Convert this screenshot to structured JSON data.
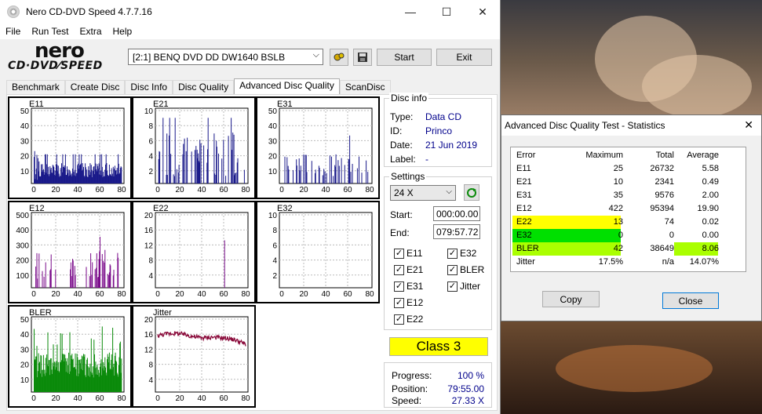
{
  "window": {
    "title": "Nero CD-DVD Speed 4.7.7.16",
    "min": "—",
    "max": "☐",
    "close": "✕"
  },
  "menu": [
    "File",
    "Run Test",
    "Extra",
    "Help"
  ],
  "logo": {
    "top": "nero",
    "bottom": "CD·DVD⁄SPEED"
  },
  "drive": {
    "value": "[2:1]   BENQ DVD DD DW1640 BSLB"
  },
  "buttons": {
    "start": "Start",
    "exit": "Exit"
  },
  "tabs": [
    "Benchmark",
    "Create Disc",
    "Disc Info",
    "Disc Quality",
    "Advanced Disc Quality",
    "ScanDisc"
  ],
  "active_tab": "Advanced Disc Quality",
  "disc_info": {
    "title": "Disc info",
    "type_label": "Type:",
    "type": "Data CD",
    "id_label": "ID:",
    "id": "Princo",
    "date_label": "Date:",
    "date": "21 Jun 2019",
    "label_label": "Label:",
    "label": "-"
  },
  "settings": {
    "title": "Settings",
    "speed": "24 X",
    "start_label": "Start:",
    "start": "000:00.00",
    "end_label": "End:",
    "end": "079:57.72",
    "checks": [
      {
        "label": "E11",
        "checked": true
      },
      {
        "label": "E32",
        "checked": true
      },
      {
        "label": "E21",
        "checked": true
      },
      {
        "label": "BLER",
        "checked": true
      },
      {
        "label": "E31",
        "checked": true
      },
      {
        "label": "Jitter",
        "checked": true
      },
      {
        "label": "E12",
        "checked": true
      },
      {
        "label": "E22",
        "checked": true
      }
    ]
  },
  "class": "Class 3",
  "progress": {
    "progress_label": "Progress:",
    "progress": "100 %",
    "position_label": "Position:",
    "position": "79:55.00",
    "speed_label": "Speed:",
    "speed": "27.33 X"
  },
  "stats": {
    "title": "Advanced Disc Quality Test - Statistics",
    "close": "✕",
    "headers": [
      "Error",
      "Maximum",
      "Total",
      "Average"
    ],
    "rows": [
      {
        "name": "E11",
        "max": "25",
        "total": "26732",
        "avg": "5.58"
      },
      {
        "name": "E21",
        "max": "10",
        "total": "2341",
        "avg": "0.49"
      },
      {
        "name": "E31",
        "max": "35",
        "total": "9576",
        "avg": "2.00"
      },
      {
        "name": "E12",
        "max": "422",
        "total": "95394",
        "avg": "19.90"
      },
      {
        "name": "E22",
        "max": "13",
        "total": "74",
        "avg": "0.02"
      },
      {
        "name": "E32",
        "max": "0",
        "total": "0",
        "avg": "0.00"
      },
      {
        "name": "BLER",
        "max": "42",
        "total": "38649",
        "avg": "8.06"
      },
      {
        "name": "Jitter",
        "max": "17.5%",
        "total": "n/a",
        "avg": "14.07%"
      }
    ],
    "copy": "Copy",
    "close_btn": "Close"
  },
  "colors": {
    "blue": "#1a1a8a",
    "purple": "#7a0a8a",
    "green": "#0a8a0a",
    "maroon": "#8a0a3a"
  },
  "chart_data": [
    {
      "type": "bar",
      "title": "E11",
      "xticks": [
        "0",
        "20",
        "40",
        "60",
        "80"
      ],
      "yticks": [
        "50",
        "40",
        "30",
        "20",
        "10"
      ],
      "ylim": [
        0,
        50
      ],
      "xlim": [
        0,
        80
      ],
      "color": "blue"
    },
    {
      "type": "bar",
      "title": "E21",
      "xticks": [
        "0",
        "20",
        "40",
        "60",
        "80"
      ],
      "yticks": [
        "10",
        "8",
        "6",
        "4",
        "2"
      ],
      "ylim": [
        0,
        10
      ],
      "xlim": [
        0,
        80
      ],
      "color": "blue"
    },
    {
      "type": "bar",
      "title": "E31",
      "xticks": [
        "0",
        "20",
        "40",
        "60",
        "80"
      ],
      "yticks": [
        "50",
        "40",
        "30",
        "20",
        "10"
      ],
      "ylim": [
        0,
        50
      ],
      "xlim": [
        0,
        80
      ],
      "color": "blue"
    },
    {
      "type": "bar",
      "title": "E12",
      "xticks": [
        "0",
        "20",
        "40",
        "60",
        "80"
      ],
      "yticks": [
        "500",
        "400",
        "300",
        "200",
        "100"
      ],
      "ylim": [
        0,
        500
      ],
      "xlim": [
        0,
        80
      ],
      "color": "purple"
    },
    {
      "type": "bar",
      "title": "E22",
      "xticks": [
        "0",
        "20",
        "40",
        "60",
        "80"
      ],
      "yticks": [
        "20",
        "16",
        "12",
        "8",
        "4"
      ],
      "ylim": [
        0,
        20
      ],
      "xlim": [
        0,
        80
      ],
      "color": "purple"
    },
    {
      "type": "bar",
      "title": "E32",
      "xticks": [
        "0",
        "20",
        "40",
        "60",
        "80"
      ],
      "yticks": [
        "10",
        "8",
        "6",
        "4",
        "2"
      ],
      "ylim": [
        0,
        10
      ],
      "xlim": [
        0,
        80
      ],
      "color": "purple"
    },
    {
      "type": "bar",
      "title": "BLER",
      "xticks": [
        "0",
        "20",
        "40",
        "60",
        "80"
      ],
      "yticks": [
        "50",
        "40",
        "30",
        "20",
        "10"
      ],
      "ylim": [
        0,
        50
      ],
      "xlim": [
        0,
        80
      ],
      "color": "green"
    },
    {
      "type": "line",
      "title": "Jitter",
      "xticks": [
        "0",
        "20",
        "40",
        "60",
        "80"
      ],
      "yticks": [
        "20",
        "16",
        "12",
        "8",
        "4"
      ],
      "ylim": [
        0,
        20
      ],
      "xlim": [
        0,
        80
      ],
      "color": "maroon"
    }
  ]
}
